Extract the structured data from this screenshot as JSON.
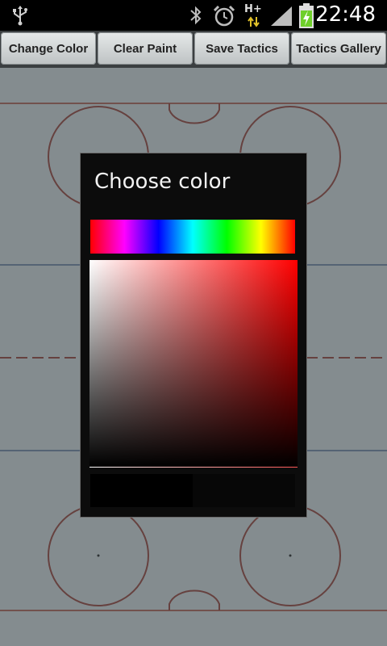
{
  "status_bar": {
    "time": "22:48",
    "network_label": "H+",
    "icons": [
      "usb-icon",
      "bluetooth-icon",
      "alarm-icon",
      "data-transfer-icon",
      "signal-icon",
      "battery-charging-icon"
    ]
  },
  "toolbar": {
    "buttons": [
      {
        "label": "Change Color"
      },
      {
        "label": "Clear Paint"
      },
      {
        "label": "Save Tactics"
      },
      {
        "label": "Tactics Gallery"
      }
    ]
  },
  "dialog": {
    "title": "Choose color",
    "hue_colors": [
      "#ff0000",
      "#ff00ff",
      "#0000ff",
      "#00ffff",
      "#00ff00",
      "#ffff00",
      "#ff0000"
    ],
    "selected_hue": "#ff0000",
    "old_color": "#000000",
    "new_color": "#070707"
  },
  "colors": {
    "rink_bg": "#cfd6d8",
    "rink_lines_red": "#a0463c",
    "rink_lines_blue": "#5a6a8a"
  }
}
